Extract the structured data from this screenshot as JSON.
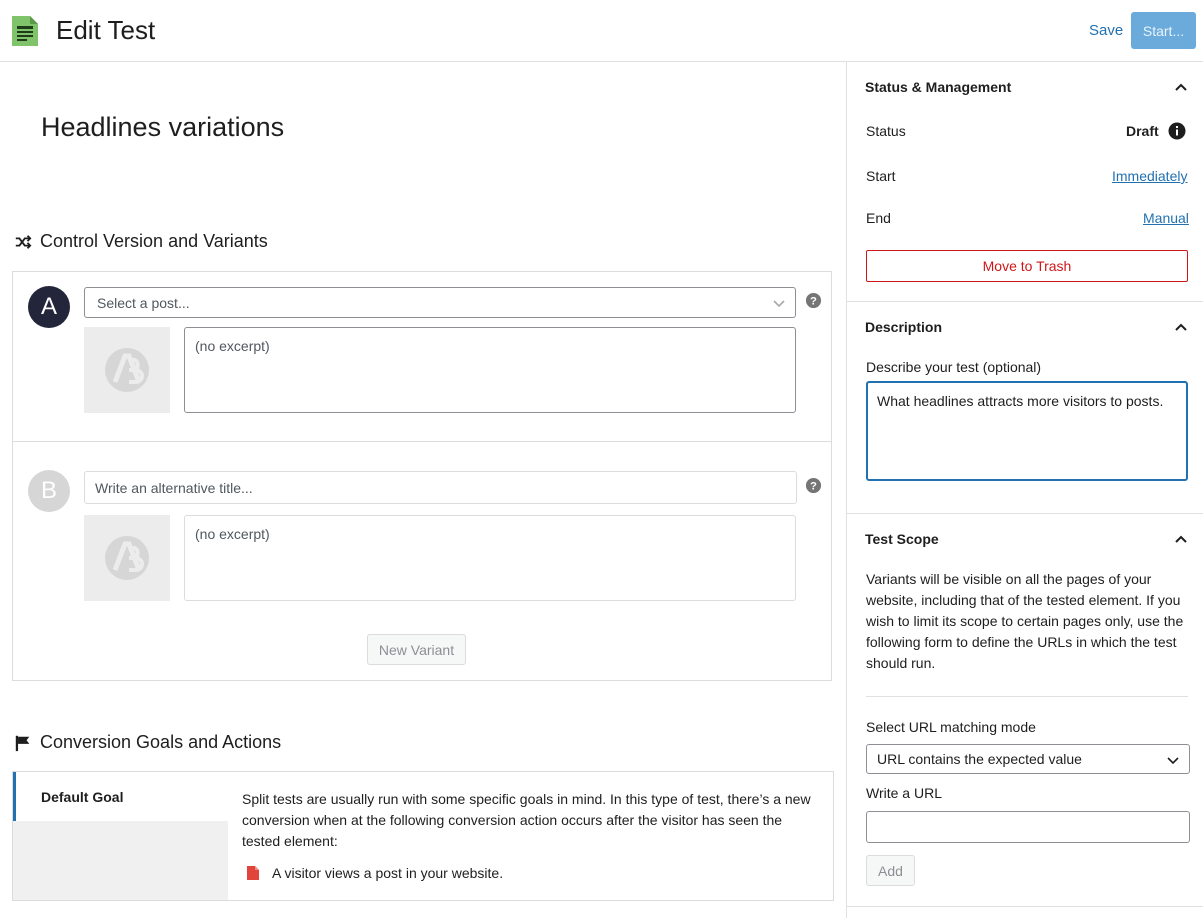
{
  "header": {
    "title": "Edit Test",
    "save_label": "Save",
    "start_label": "Start..."
  },
  "test": {
    "name": "Headlines variations"
  },
  "variants_section": {
    "heading": "Control Version and Variants",
    "variant_a": {
      "badge": "A",
      "select_placeholder": "Select a post...",
      "excerpt": "(no excerpt)"
    },
    "variant_b": {
      "badge": "B",
      "title_placeholder": "Write an alternative title...",
      "excerpt": "(no excerpt)"
    },
    "new_variant_label": "New Variant"
  },
  "goals_section": {
    "heading": "Conversion Goals and Actions",
    "goal_tab": "Default Goal",
    "description": "Split tests are usually run with some specific goals in mind. In this type of test, there’s a new conversion when at the following conversion action occurs after the visitor has seen the tested element:",
    "action": "A visitor views a post in your website."
  },
  "sidebar": {
    "status_panel": {
      "title": "Status & Management",
      "status_label": "Status",
      "status_value": "Draft",
      "start_label": "Start",
      "start_value": "Immediately",
      "end_label": "End",
      "end_value": "Manual",
      "trash_label": "Move to Trash"
    },
    "description_panel": {
      "title": "Description",
      "field_label": "Describe your test (optional)",
      "field_value": "What headlines attracts more visitors to posts."
    },
    "scope_panel": {
      "title": "Test Scope",
      "text": "Variants will be visible on all the pages of your website, including that of the tested element. If you wish to limit its scope to certain pages only, use the following form to define the URLs in which the test should run.",
      "mode_label": "Select URL matching mode",
      "mode_value": "URL contains the expected value",
      "url_label": "Write a URL",
      "url_value": "",
      "add_label": "Add"
    }
  },
  "colors": {
    "accent": "#2271b1",
    "danger": "#cc1818",
    "badge_dark": "#23263a",
    "start_button": "#5aa3d8"
  },
  "icons": [
    "test-page-icon",
    "shuffle-icon",
    "flag-icon",
    "help-icon",
    "info-icon",
    "chevron-up-icon",
    "chevron-down-icon",
    "placeholder-logo-icon",
    "document-icon"
  ]
}
